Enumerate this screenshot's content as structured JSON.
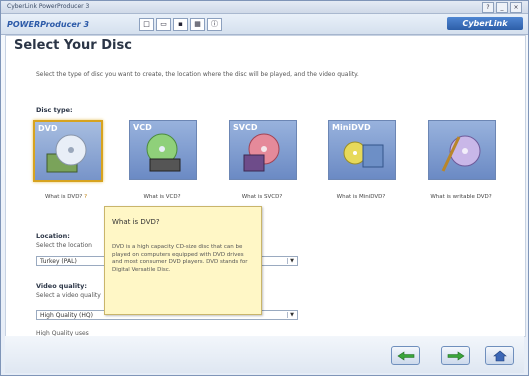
{
  "window": {
    "title": "CyberLink PowerProducer 3",
    "buttons": [
      "?",
      "_",
      "×"
    ]
  },
  "toolbar": {
    "brand": "POWERProducer 3",
    "logo": "CyberLink"
  },
  "page": {
    "title": "Select Your Disc",
    "instructions": "Select the type of disc you want to create, the location where the disc will be played, and the video quality."
  },
  "disc_type": {
    "label": "Disc type:",
    "options": [
      {
        "label": "DVD",
        "what": "What is DVD?"
      },
      {
        "label": "VCD",
        "what": "What is VCD?"
      },
      {
        "label": "SVCD",
        "what": "What is SVCD?"
      },
      {
        "label": "MiniDVD",
        "what": "What is MiniDVD?"
      },
      {
        "label": "",
        "what": "What is writable DVD?"
      }
    ],
    "selected": "DVD"
  },
  "location": {
    "label": "Location:",
    "sub": "Select the location",
    "value": "Turkey (PAL)"
  },
  "quality": {
    "label": "Video quality:",
    "sub": "Select a video quality",
    "value": "High Quality (HQ)",
    "footer": "High Quality uses"
  },
  "tooltip": {
    "title": "What is DVD?",
    "text": "DVD is a high capacity CD-size disc that can be played on computers equipped with DVD drives and most consumer DVD players. DVD stands for Digital Versatile Disc."
  },
  "colors": {
    "accent": "#2c5aa8",
    "tooltip_bg": "#fff7c6",
    "selected_border": "#d7a31f"
  }
}
